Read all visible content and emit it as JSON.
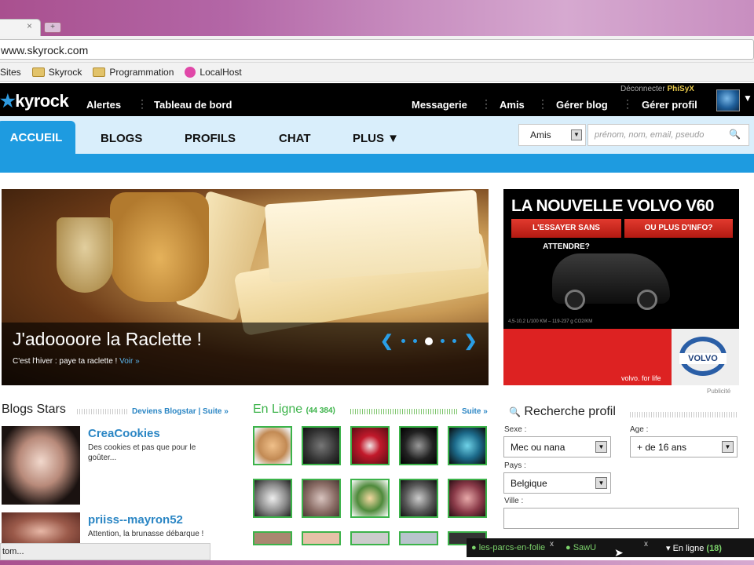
{
  "browser": {
    "new_tab_symbol": "+",
    "tab_close": "×",
    "url": "www.skyrock.com",
    "bookmarks": [
      "Sites",
      "Skyrock",
      "Programmation",
      "LocalHost"
    ]
  },
  "header": {
    "logo": "kyrock",
    "logo_star": "★",
    "left_nav": [
      "Alertes",
      "Tableau de bord"
    ],
    "right_nav": [
      "Messagerie",
      "Amis",
      "Gérer blog",
      "Gérer profil"
    ],
    "logout_label": "Déconnecter",
    "username": "PhiSyX",
    "avatar_caret": "▼"
  },
  "nav": {
    "active": "ACCUEIL",
    "items": [
      "BLOGS",
      "PROFILS",
      "CHAT",
      "PLUS ▼"
    ],
    "search_scope": "Amis",
    "search_placeholder": "prénom, nom, email, pseudo",
    "search_icon": "🔍"
  },
  "hero": {
    "title": "J'adoooore la Raclette !",
    "subtitle": "C'est l'hiver : paye ta raclette !",
    "subtitle_link": "Voir »",
    "prev": "❮",
    "next": "❯",
    "slide_count": 5,
    "active_slide": 3
  },
  "ad": {
    "title": "LA NOUVELLE VOLVO V60",
    "btn1": "L'ESSAYER SANS ATTENDRE?",
    "btn2": "OU PLUS D'INFO?",
    "fine_print": "4,5-10,2 L/100 KM – 119-237 g CO2/KM",
    "slogan": "volvo. for life",
    "brand": "VOLVO",
    "publicite": "Publicité"
  },
  "blogs_stars": {
    "title": "Blogs Stars",
    "link": "Deviens Blogstar | Suite »",
    "items": [
      {
        "name": "CreaCookies",
        "desc": "Des cookies et pas que pour le goûter..."
      },
      {
        "name": "priiss--mayron52",
        "desc": "Attention, la brunasse débarque !"
      }
    ]
  },
  "en_ligne": {
    "title": "En Ligne",
    "count": "(44 384)",
    "link": "Suite »"
  },
  "recherche": {
    "title": "Recherche profil",
    "icon": "🔍",
    "sexe_label": "Sexe :",
    "sexe_value": "Mec ou nana",
    "age_label": "Age :",
    "age_value": "+ de 16 ans",
    "pays_label": "Pays :",
    "pays_value": "Belgique",
    "ville_label": "Ville :",
    "dropdown_symbol": "▼"
  },
  "status_bar": "tom...",
  "chat": {
    "tab1": "● les-parcs-en-folie",
    "tab2": "● SawU",
    "close": "x",
    "online_label": "▾ En ligne",
    "online_count": "(18)"
  },
  "colors": {
    "accent": "#1e9be0",
    "green": "#3cb34a",
    "link": "#2b86c4"
  }
}
